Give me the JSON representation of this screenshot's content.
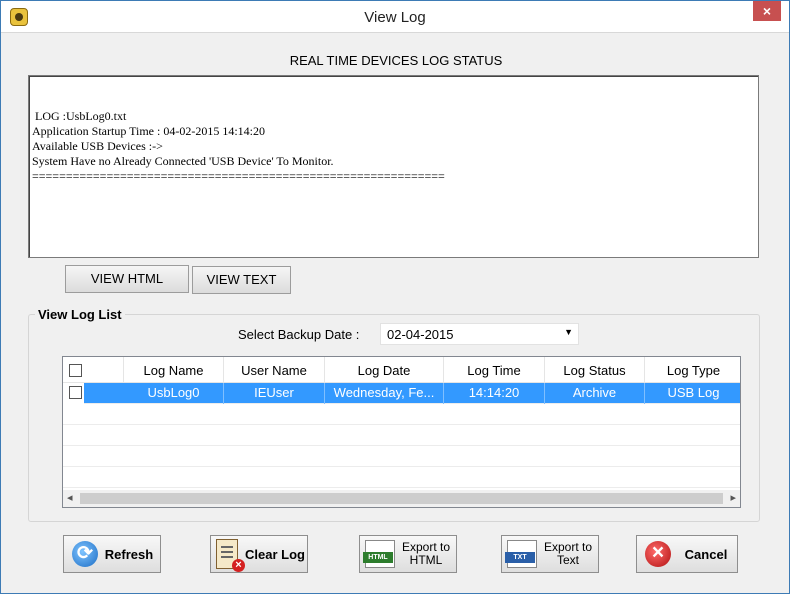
{
  "window": {
    "title": "View Log",
    "close_glyph": "×"
  },
  "section_title": "REAL TIME DEVICES  LOG STATUS",
  "log_text": " LOG :UsbLog0.txt\nApplication Startup Time : 04-02-2015 14:14:20\nAvailable USB Devices :->\nSystem Have no Already Connected 'USB Device' To Monitor.\n=============================================================",
  "view_buttons": {
    "html": "VIEW HTML",
    "text": "VIEW  TEXT"
  },
  "log_list": {
    "group_label": "View Log List",
    "date_label": "Select Backup Date :",
    "date_value": "02-04-2015",
    "dropdown_glyph": "▼",
    "columns": [
      "Log Name",
      "User Name",
      "Log Date",
      "Log Time",
      "Log Status",
      "Log Type"
    ],
    "rows": [
      {
        "selected": true,
        "log_name": "UsbLog0",
        "user_name": "IEUser",
        "log_date": "Wednesday, Fe...",
        "log_time": "14:14:20",
        "log_status": "Archive",
        "log_type": "USB Log"
      }
    ]
  },
  "actions": {
    "refresh": "Refresh",
    "clear_log": "Clear Log",
    "export_html": "Export to HTML",
    "export_text": "Export to Text",
    "cancel": "Cancel"
  },
  "colors": {
    "selection": "#3399ff",
    "title_bar": "#ffffff",
    "close_button": "#c75050"
  },
  "icons": [
    "app-icon",
    "close-icon",
    "refresh-icon",
    "clear-log-icon",
    "html-file-icon",
    "txt-file-icon",
    "cancel-icon",
    "chevron-down-icon"
  ]
}
